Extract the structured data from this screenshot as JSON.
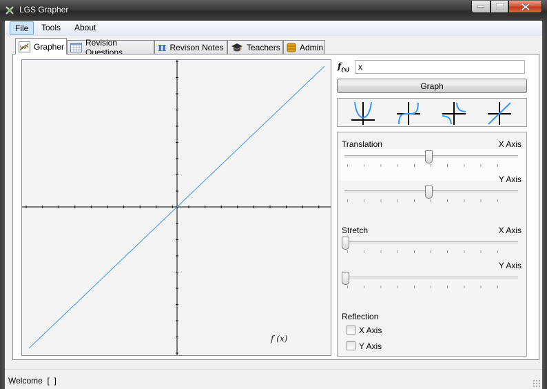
{
  "window": {
    "title": "LGS Grapher"
  },
  "menu": {
    "items": [
      "File",
      "Tools",
      "About"
    ]
  },
  "tabs": [
    "Grapher",
    "Revision Questions",
    "Revison Notes",
    "Teachers",
    "Admin"
  ],
  "grapher": {
    "fx_label": "f",
    "fx_sub": "(x)",
    "function_value": "x",
    "graph_button": "Graph",
    "graph_label": "f (x)",
    "shape_icons": [
      "parabola-icon",
      "cubic-icon",
      "reciprocal-icon",
      "linear-icon"
    ],
    "translation": {
      "title": "Translation",
      "x_label": "X Axis",
      "y_label": "Y Axis",
      "x_value": 0.5,
      "y_value": 0.5
    },
    "stretch": {
      "title": "Stretch",
      "x_label": "X Axis",
      "y_label": "Y Axis",
      "x_value": 0,
      "y_value": 0
    },
    "reflection": {
      "title": "Reflection",
      "x_label": "X Axis",
      "y_label": "Y Axis",
      "x_checked": false,
      "y_checked": false
    }
  },
  "status": {
    "text": "Welcome  [  ]"
  },
  "colors": {
    "curve": "#3f97e8",
    "accent": "#3399ff"
  }
}
